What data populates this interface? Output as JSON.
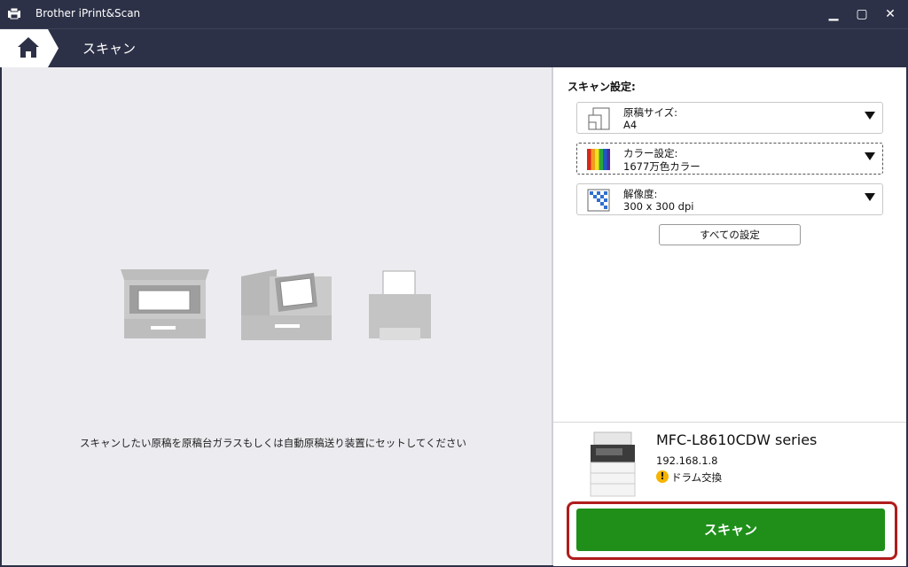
{
  "window": {
    "title": "Brother iPrint&Scan",
    "minimize": "▁",
    "maximize": "▢",
    "close": "✕"
  },
  "nav": {
    "page_title": "スキャン"
  },
  "main": {
    "instruction": "スキャンしたい原稿を原稿台ガラスもしくは自動原稿送り装置にセットしてください"
  },
  "settings": {
    "heading": "スキャン設定:",
    "dropdowns": [
      {
        "label": "原稿サイズ:",
        "value": "A4",
        "icon": "document-size-icon"
      },
      {
        "label": "カラー設定:",
        "value": "1677万色カラー",
        "icon": "color-bars-icon"
      },
      {
        "label": "解像度:",
        "value": "300 x 300 dpi",
        "icon": "resolution-grid-icon"
      }
    ],
    "all_settings_label": "すべての設定"
  },
  "device": {
    "name": "MFC-L8610CDW series",
    "ip": "192.168.1.8",
    "warning_icon": "!",
    "warning_text": "ドラム交換"
  },
  "actions": {
    "scan_label": "スキャン"
  },
  "colors": {
    "titlebar": "#2d3147",
    "scan_button": "#1f8f1a",
    "highlight": "#b01c1c",
    "warning": "#f5b400"
  }
}
